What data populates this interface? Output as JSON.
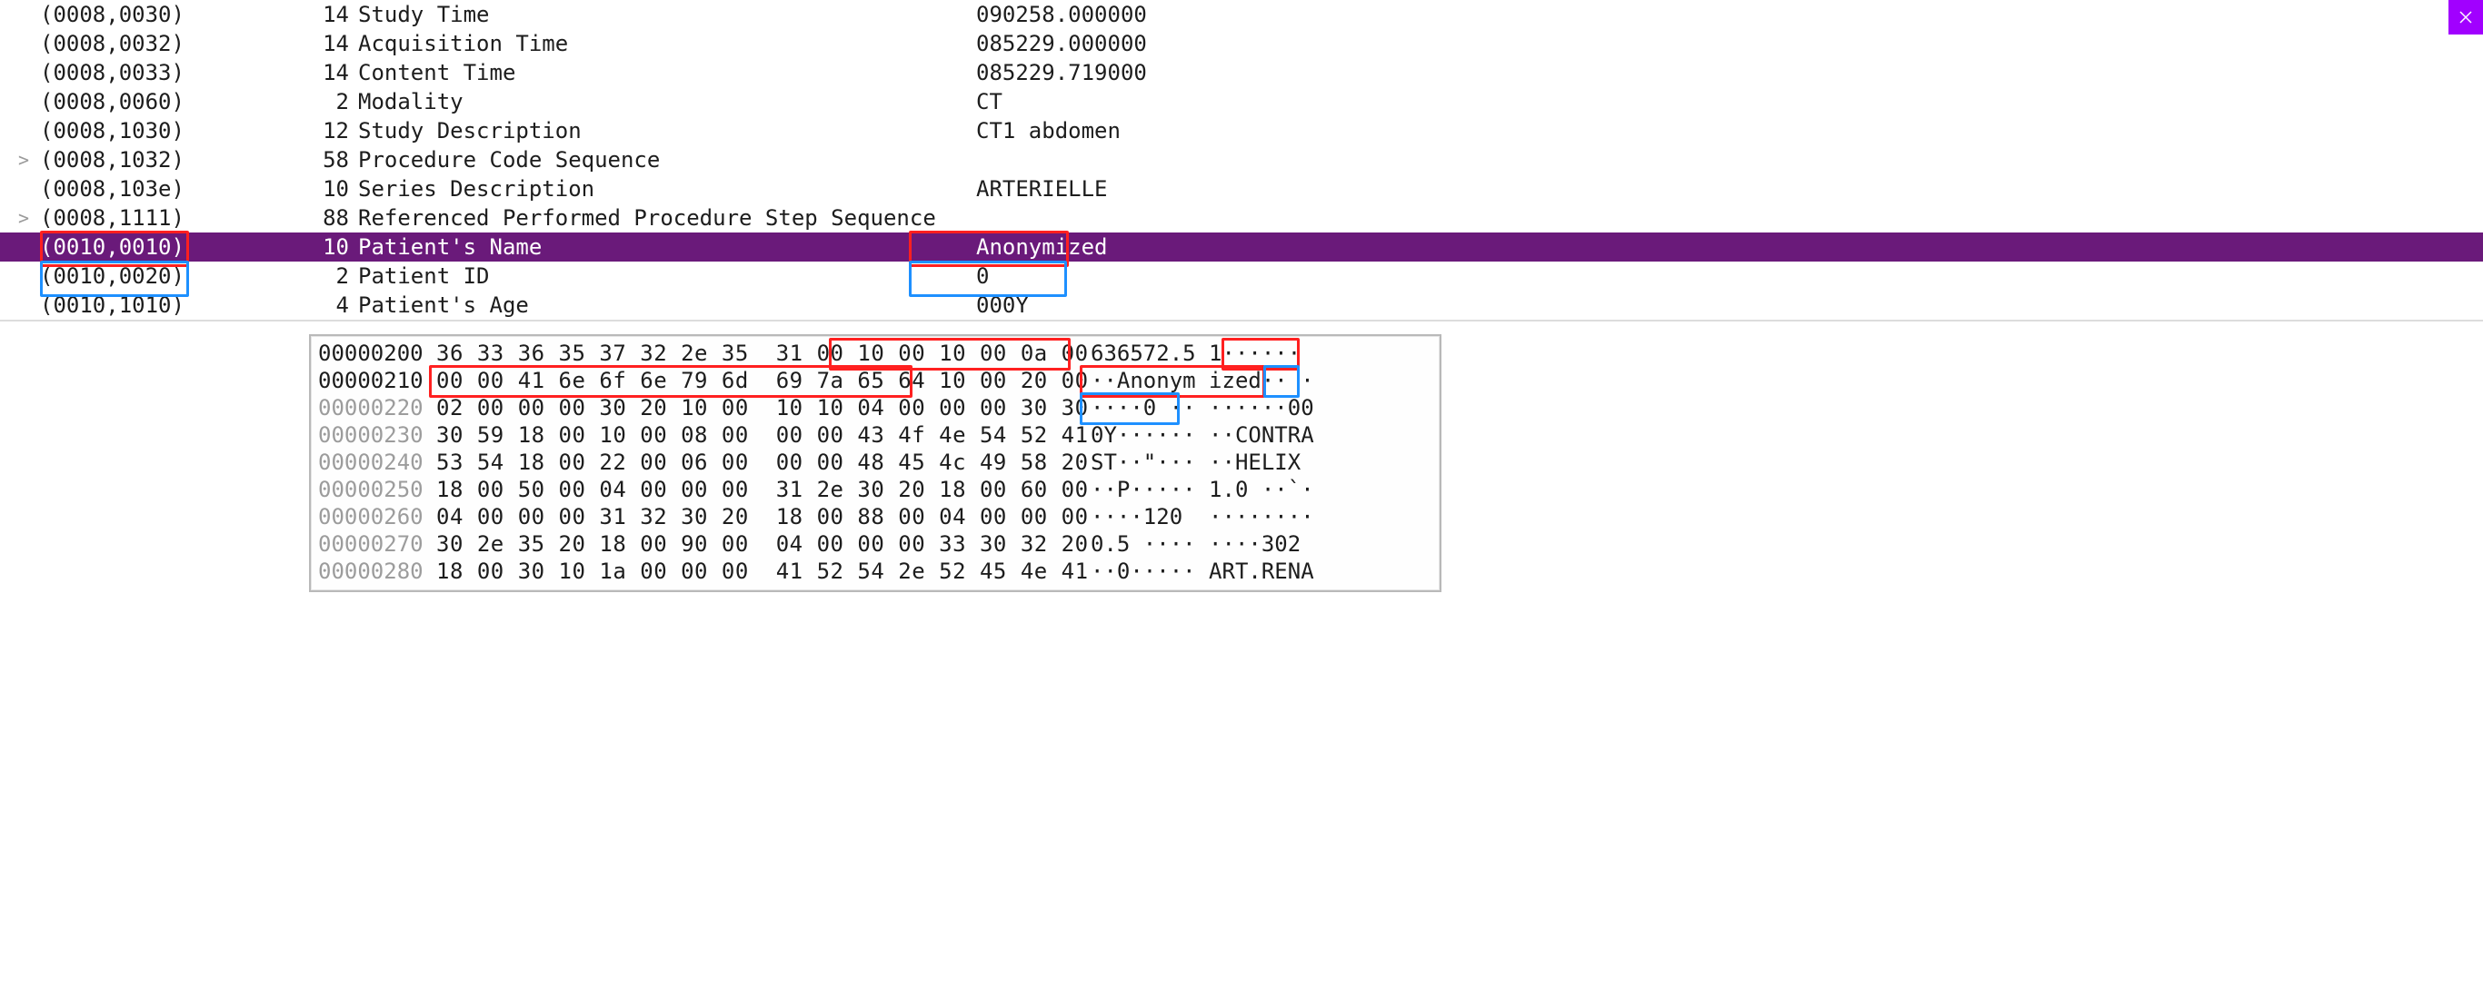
{
  "colors": {
    "highlight_red": "#ff2020",
    "highlight_blue": "#1e90ff",
    "selected_row_bg": "#6a1a7a",
    "close_bg": "#a100ff"
  },
  "close_label": "Close",
  "dicom_rows": [
    {
      "exp": "",
      "tag": "(0008,0030)",
      "len": "14",
      "desc": "Study Time",
      "val": "090258.000000"
    },
    {
      "exp": "",
      "tag": "(0008,0032)",
      "len": "14",
      "desc": "Acquisition Time",
      "val": "085229.000000"
    },
    {
      "exp": "",
      "tag": "(0008,0033)",
      "len": "14",
      "desc": "Content Time",
      "val": "085229.719000"
    },
    {
      "exp": "",
      "tag": "(0008,0060)",
      "len": "2",
      "desc": "Modality",
      "val": "CT"
    },
    {
      "exp": "",
      "tag": "(0008,1030)",
      "len": "12",
      "desc": "Study Description",
      "val": "CT1 abdomen"
    },
    {
      "exp": ">",
      "tag": "(0008,1032)",
      "len": "58",
      "desc": "Procedure Code Sequence",
      "val": ""
    },
    {
      "exp": "",
      "tag": "(0008,103e)",
      "len": "10",
      "desc": "Series Description",
      "val": "ARTERIELLE"
    },
    {
      "exp": ">",
      "tag": "(0008,1111)",
      "len": "88",
      "desc": "Referenced Performed Procedure Step Sequence",
      "val": ""
    },
    {
      "exp": "",
      "tag": "(0010,0010)",
      "len": "10",
      "desc": "Patient's Name",
      "val": "Anonymized",
      "selected": true
    },
    {
      "exp": "",
      "tag": "(0010,0020)",
      "len": "2",
      "desc": "Patient ID",
      "val": "0"
    },
    {
      "exp": "",
      "tag": "(0010,1010)",
      "len": "4",
      "desc": "Patient's Age",
      "val": "000Y"
    }
  ],
  "highlights": {
    "row8_tag": {
      "color": "red"
    },
    "row8_val": {
      "color": "red"
    },
    "row9_tag": {
      "color": "blue"
    },
    "row9_val": {
      "color": "blue"
    }
  },
  "hex_rows": [
    {
      "offset": "00000200",
      "bytes": "36 33 36 35 37 32 2e 35  31 00 10 00 10 00 0a 00",
      "ascii": "636572.5 1······"
    },
    {
      "offset": "00000210",
      "bytes": "00 00 41 6e 6f 6e 79 6d  69 7a 65 64 10 00 20 00",
      "ascii": "··Anonym ized·· ·"
    },
    {
      "offset": "00000220",
      "bytes": "02 00 00 00 30 20 10 00  10 10 04 00 00 00 30 30",
      "ascii": "····0 ·· ······00",
      "dim": true
    },
    {
      "offset": "00000230",
      "bytes": "30 59 18 00 10 00 08 00  00 00 43 4f 4e 54 52 41",
      "ascii": "0Y······ ··CONTRA",
      "dim": true
    },
    {
      "offset": "00000240",
      "bytes": "53 54 18 00 22 00 06 00  00 00 48 45 4c 49 58 20",
      "ascii": "ST··\"··· ··HELIX ",
      "dim": true
    },
    {
      "offset": "00000250",
      "bytes": "18 00 50 00 04 00 00 00  31 2e 30 20 18 00 60 00",
      "ascii": "··P····· 1.0 ··`·",
      "dim": true
    },
    {
      "offset": "00000260",
      "bytes": "04 00 00 00 31 32 30 20  18 00 88 00 04 00 00 00",
      "ascii": "····120  ········",
      "dim": true
    },
    {
      "offset": "00000270",
      "bytes": "30 2e 35 20 18 00 90 00  04 00 00 00 33 30 32 20",
      "ascii": "0.5 ···· ····302 ",
      "dim": true
    },
    {
      "offset": "00000280",
      "bytes": "18 00 30 10 1a 00 00 00  41 52 54 2e 52 45 4e 41",
      "ascii": "··0····· ART.RENA",
      "dim": true
    }
  ],
  "hex_highlights": {
    "row0_bytes_tail": {
      "color": "red"
    },
    "row1_bytes_head": {
      "color": "red"
    },
    "row0_ascii_tail": {
      "color": "red"
    },
    "row1_ascii_anon": {
      "color": "red"
    },
    "row1_ascii_tail": {
      "color": "blue"
    },
    "row2_ascii_zero": {
      "color": "blue"
    }
  }
}
